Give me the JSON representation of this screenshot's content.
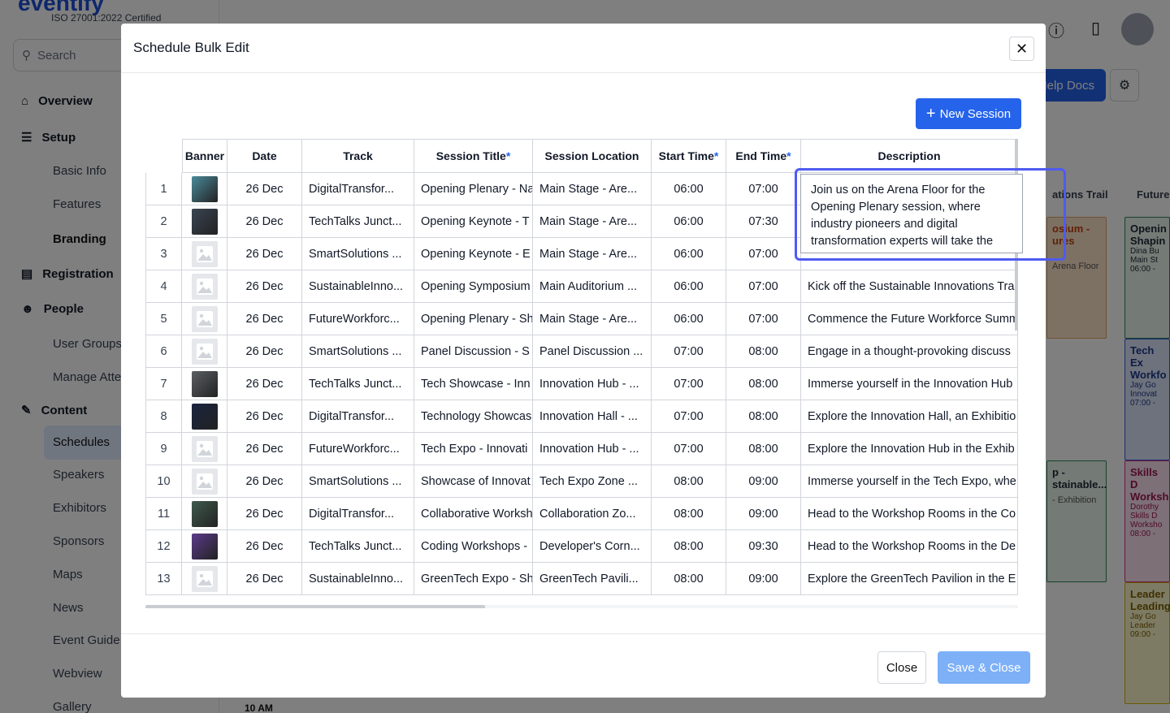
{
  "brand": {
    "name": "eventify",
    "certification": "ISO 27001:2022 Certified"
  },
  "search": {
    "placeholder": "Search"
  },
  "sidebar": {
    "overview": "Overview",
    "setup": "Setup",
    "basic_info": "Basic Info",
    "features": "Features",
    "branding": "Branding",
    "registration": "Registration",
    "people": "People",
    "user_groups": "User Groups",
    "manage_attendees": "Manage Atte",
    "content": "Content",
    "schedules": "Schedules",
    "speakers": "Speakers",
    "exhibitors": "Exhibitors",
    "sponsors": "Sponsors",
    "maps": "Maps",
    "news": "News",
    "event_guide": "Event Guide",
    "webview": "Webview",
    "gallery": "Gallery"
  },
  "topbar": {
    "help_docs": "Help Docs"
  },
  "background": {
    "col_trail": "ations Trail",
    "col_future": "Future",
    "card1_title": "osium - ures",
    "card1_loc": "Arena Floor",
    "card2_title": "Openin Shapin",
    "card2_l1": "Dina Bu",
    "card2_l2": "Main St",
    "card2_l3": "06:00 -",
    "card3_title": "Tech Ex Workfo",
    "card3_l1": "Jay Go",
    "card3_l2": "Innovat",
    "card3_l3": "07:00 -",
    "card4_title": "p - stainable...",
    "card4_loc": "- Exhibition",
    "card5_title": "Skills D Worksh",
    "card5_l1": "Dorothy",
    "card5_l2": "Skills D Worksho",
    "card5_l3": "08:00 -",
    "card6_title": "Leader Leading",
    "card6_l1": "Jay Go",
    "card6_l2": "Leader",
    "card6_l3": "09:00 -",
    "time_label": "10 AM"
  },
  "modal": {
    "title": "Schedule Bulk Edit",
    "new_session": "New Session",
    "close_label": "Close",
    "save_close_label": "Save & Close",
    "editor_text": "Join us on the Arena Floor for the Opening Plenary session, where industry pioneers and digital transformation experts will take the stage by providing insights into Join industry leaders and visionaries as"
  },
  "columns": {
    "banner": "Banner",
    "date": "Date",
    "track": "Track",
    "session_title": "Session Title",
    "session_location": "Session Location",
    "start_time": "Start Time",
    "end_time": "End Time",
    "description": "Description",
    "required_mark": "*"
  },
  "rows": [
    {
      "n": "1",
      "banner": "image",
      "color": "#4a8a9a",
      "date": "26 Dec",
      "track": "DigitalTransfor...",
      "title": "Opening Plenary - Na",
      "location": "Main Stage - Are...",
      "start": "06:00",
      "end": "07:00",
      "desc": ""
    },
    {
      "n": "2",
      "banner": "image",
      "color": "#3a4452",
      "date": "26 Dec",
      "track": "TechTalks Junct...",
      "title": "Opening Keynote - T",
      "location": "Main Stage - Are...",
      "start": "06:00",
      "end": "07:30",
      "desc": ""
    },
    {
      "n": "3",
      "banner": "placeholder",
      "color": "",
      "date": "26 Dec",
      "track": "SmartSolutions ...",
      "title": "Opening Keynote - E",
      "location": "Main Stage - Are...",
      "start": "06:00",
      "end": "07:00",
      "desc": ""
    },
    {
      "n": "4",
      "banner": "placeholder",
      "color": "",
      "date": "26 Dec",
      "track": "SustainableInno...",
      "title": "Opening Symposium",
      "location": "Main Auditorium ...",
      "start": "06:00",
      "end": "07:00",
      "desc": "Kick off the Sustainable Innovations Tra"
    },
    {
      "n": "5",
      "banner": "placeholder",
      "color": "",
      "date": "26 Dec",
      "track": "FutureWorkforc...",
      "title": "Opening Plenary - Sh",
      "location": "Main Stage - Are...",
      "start": "06:00",
      "end": "07:00",
      "desc": "Commence the Future Workforce Summ"
    },
    {
      "n": "6",
      "banner": "placeholder",
      "color": "",
      "date": "26 Dec",
      "track": "SmartSolutions ...",
      "title": "Panel Discussion - S",
      "location": "Panel Discussion ...",
      "start": "07:00",
      "end": "08:00",
      "desc": "Engage in a thought-provoking discuss"
    },
    {
      "n": "7",
      "banner": "image",
      "color": "#5b5f63",
      "date": "26 Dec",
      "track": "TechTalks Junct...",
      "title": "Tech Showcase - Inn",
      "location": "Innovation Hub - ...",
      "start": "07:00",
      "end": "08:00",
      "desc": "Immerse yourself in the Innovation Hub"
    },
    {
      "n": "8",
      "banner": "image",
      "color": "#1a2440",
      "date": "26 Dec",
      "track": "DigitalTransfor...",
      "title": "Technology Showcas",
      "location": "Innovation Hall - ...",
      "start": "07:00",
      "end": "08:00",
      "desc": "Explore the Innovation Hall, an Exhibitio"
    },
    {
      "n": "9",
      "banner": "placeholder",
      "color": "",
      "date": "26 Dec",
      "track": "FutureWorkforc...",
      "title": "Tech Expo - Innovati",
      "location": "Innovation Hub - ...",
      "start": "07:00",
      "end": "08:00",
      "desc": "Explore the Innovation Hub in the Exhib"
    },
    {
      "n": "10",
      "banner": "placeholder",
      "color": "",
      "date": "26 Dec",
      "track": "SmartSolutions ...",
      "title": "Showcase of Innovat",
      "location": "Tech Expo Zone ...",
      "start": "08:00",
      "end": "09:00",
      "desc": "Immerse yourself in the Tech Expo, whe"
    },
    {
      "n": "11",
      "banner": "image",
      "color": "#3f5a4d",
      "date": "26 Dec",
      "track": "DigitalTransfor...",
      "title": "Collaborative Worksh",
      "location": "Collaboration Zo...",
      "start": "08:00",
      "end": "09:00",
      "desc": "Head to the Workshop Rooms in the Co"
    },
    {
      "n": "12",
      "banner": "image",
      "color": "#5b3a8a",
      "date": "26 Dec",
      "track": "TechTalks Junct...",
      "title": "Coding Workshops -",
      "location": "Developer's Corn...",
      "start": "08:00",
      "end": "09:30",
      "desc": "Head to the Workshop Rooms in the De"
    },
    {
      "n": "13",
      "banner": "placeholder",
      "color": "",
      "date": "26 Dec",
      "track": "SustainableInno...",
      "title": "GreenTech Expo - Sh",
      "location": "GreenTech Pavili...",
      "start": "08:00",
      "end": "09:00",
      "desc": "Explore the GreenTech Pavilion in the E"
    }
  ]
}
